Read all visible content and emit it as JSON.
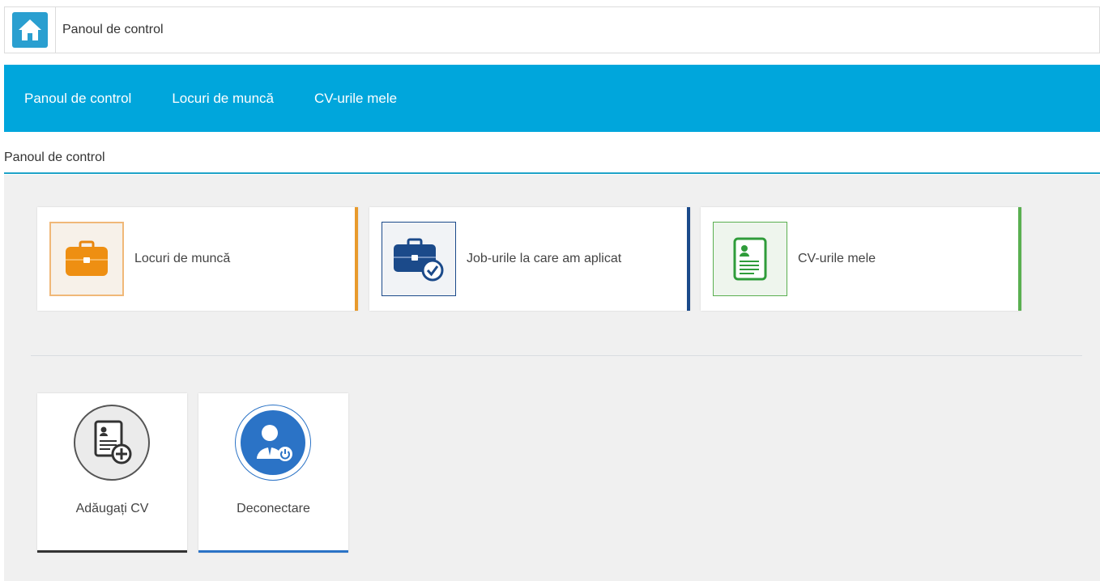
{
  "topbar": {
    "title": "Panoul de control",
    "home_icon": "home-icon"
  },
  "nav": {
    "items": [
      {
        "label": "Panoul de control"
      },
      {
        "label": "Locuri de muncă"
      },
      {
        "label": "CV-urile mele"
      }
    ]
  },
  "breadcrumb": {
    "label": "Panoul de control"
  },
  "cards": [
    {
      "label": "Locuri de muncă",
      "icon": "briefcase-icon",
      "accent": "#e89a2c"
    },
    {
      "label": "Job-urile la care am aplicat",
      "icon": "briefcase-check-icon",
      "accent": "#1b4a8a"
    },
    {
      "label": "CV-urile mele",
      "icon": "cv-document-icon",
      "accent": "#5aaf50"
    }
  ],
  "tiles": [
    {
      "label": "Adăugați CV",
      "icon": "add-cv-icon",
      "accent": "#333333"
    },
    {
      "label": "Deconectare",
      "icon": "logout-user-icon",
      "accent": "#2b73c6"
    }
  ],
  "colors": {
    "nav_bg": "#00a6dc",
    "home_bg": "#2a9fd0",
    "breadcrumb_line": "#1ea3c8"
  }
}
